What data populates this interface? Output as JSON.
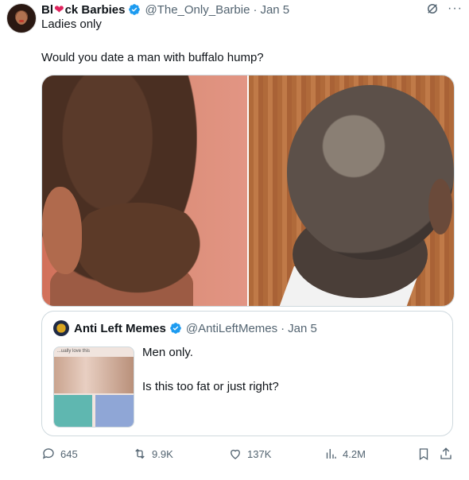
{
  "tweet": {
    "name_part1": "Bl",
    "name_heart": "❤",
    "name_part2": "ck Barbies",
    "handle": "@The_Only_Barbie",
    "separator": "·",
    "date": "Jan 5",
    "subtitle": "Ladies only",
    "text": "Would you date a man with buffalo hump?",
    "more_label": "···"
  },
  "quoted": {
    "name": "Anti Left Memes",
    "handle": "@AntiLeftMemes",
    "separator": "·",
    "date": "Jan 5",
    "line1": "Men only.",
    "line2": "Is this too fat or just right?",
    "thumb_caption": "...ually love this"
  },
  "actions": {
    "replies": "645",
    "reposts": "9.9K",
    "likes": "137K",
    "views": "4.2M"
  },
  "colors": {
    "verified": "#1d9bf0",
    "muted": "#536471",
    "heart": "#e0245e"
  }
}
